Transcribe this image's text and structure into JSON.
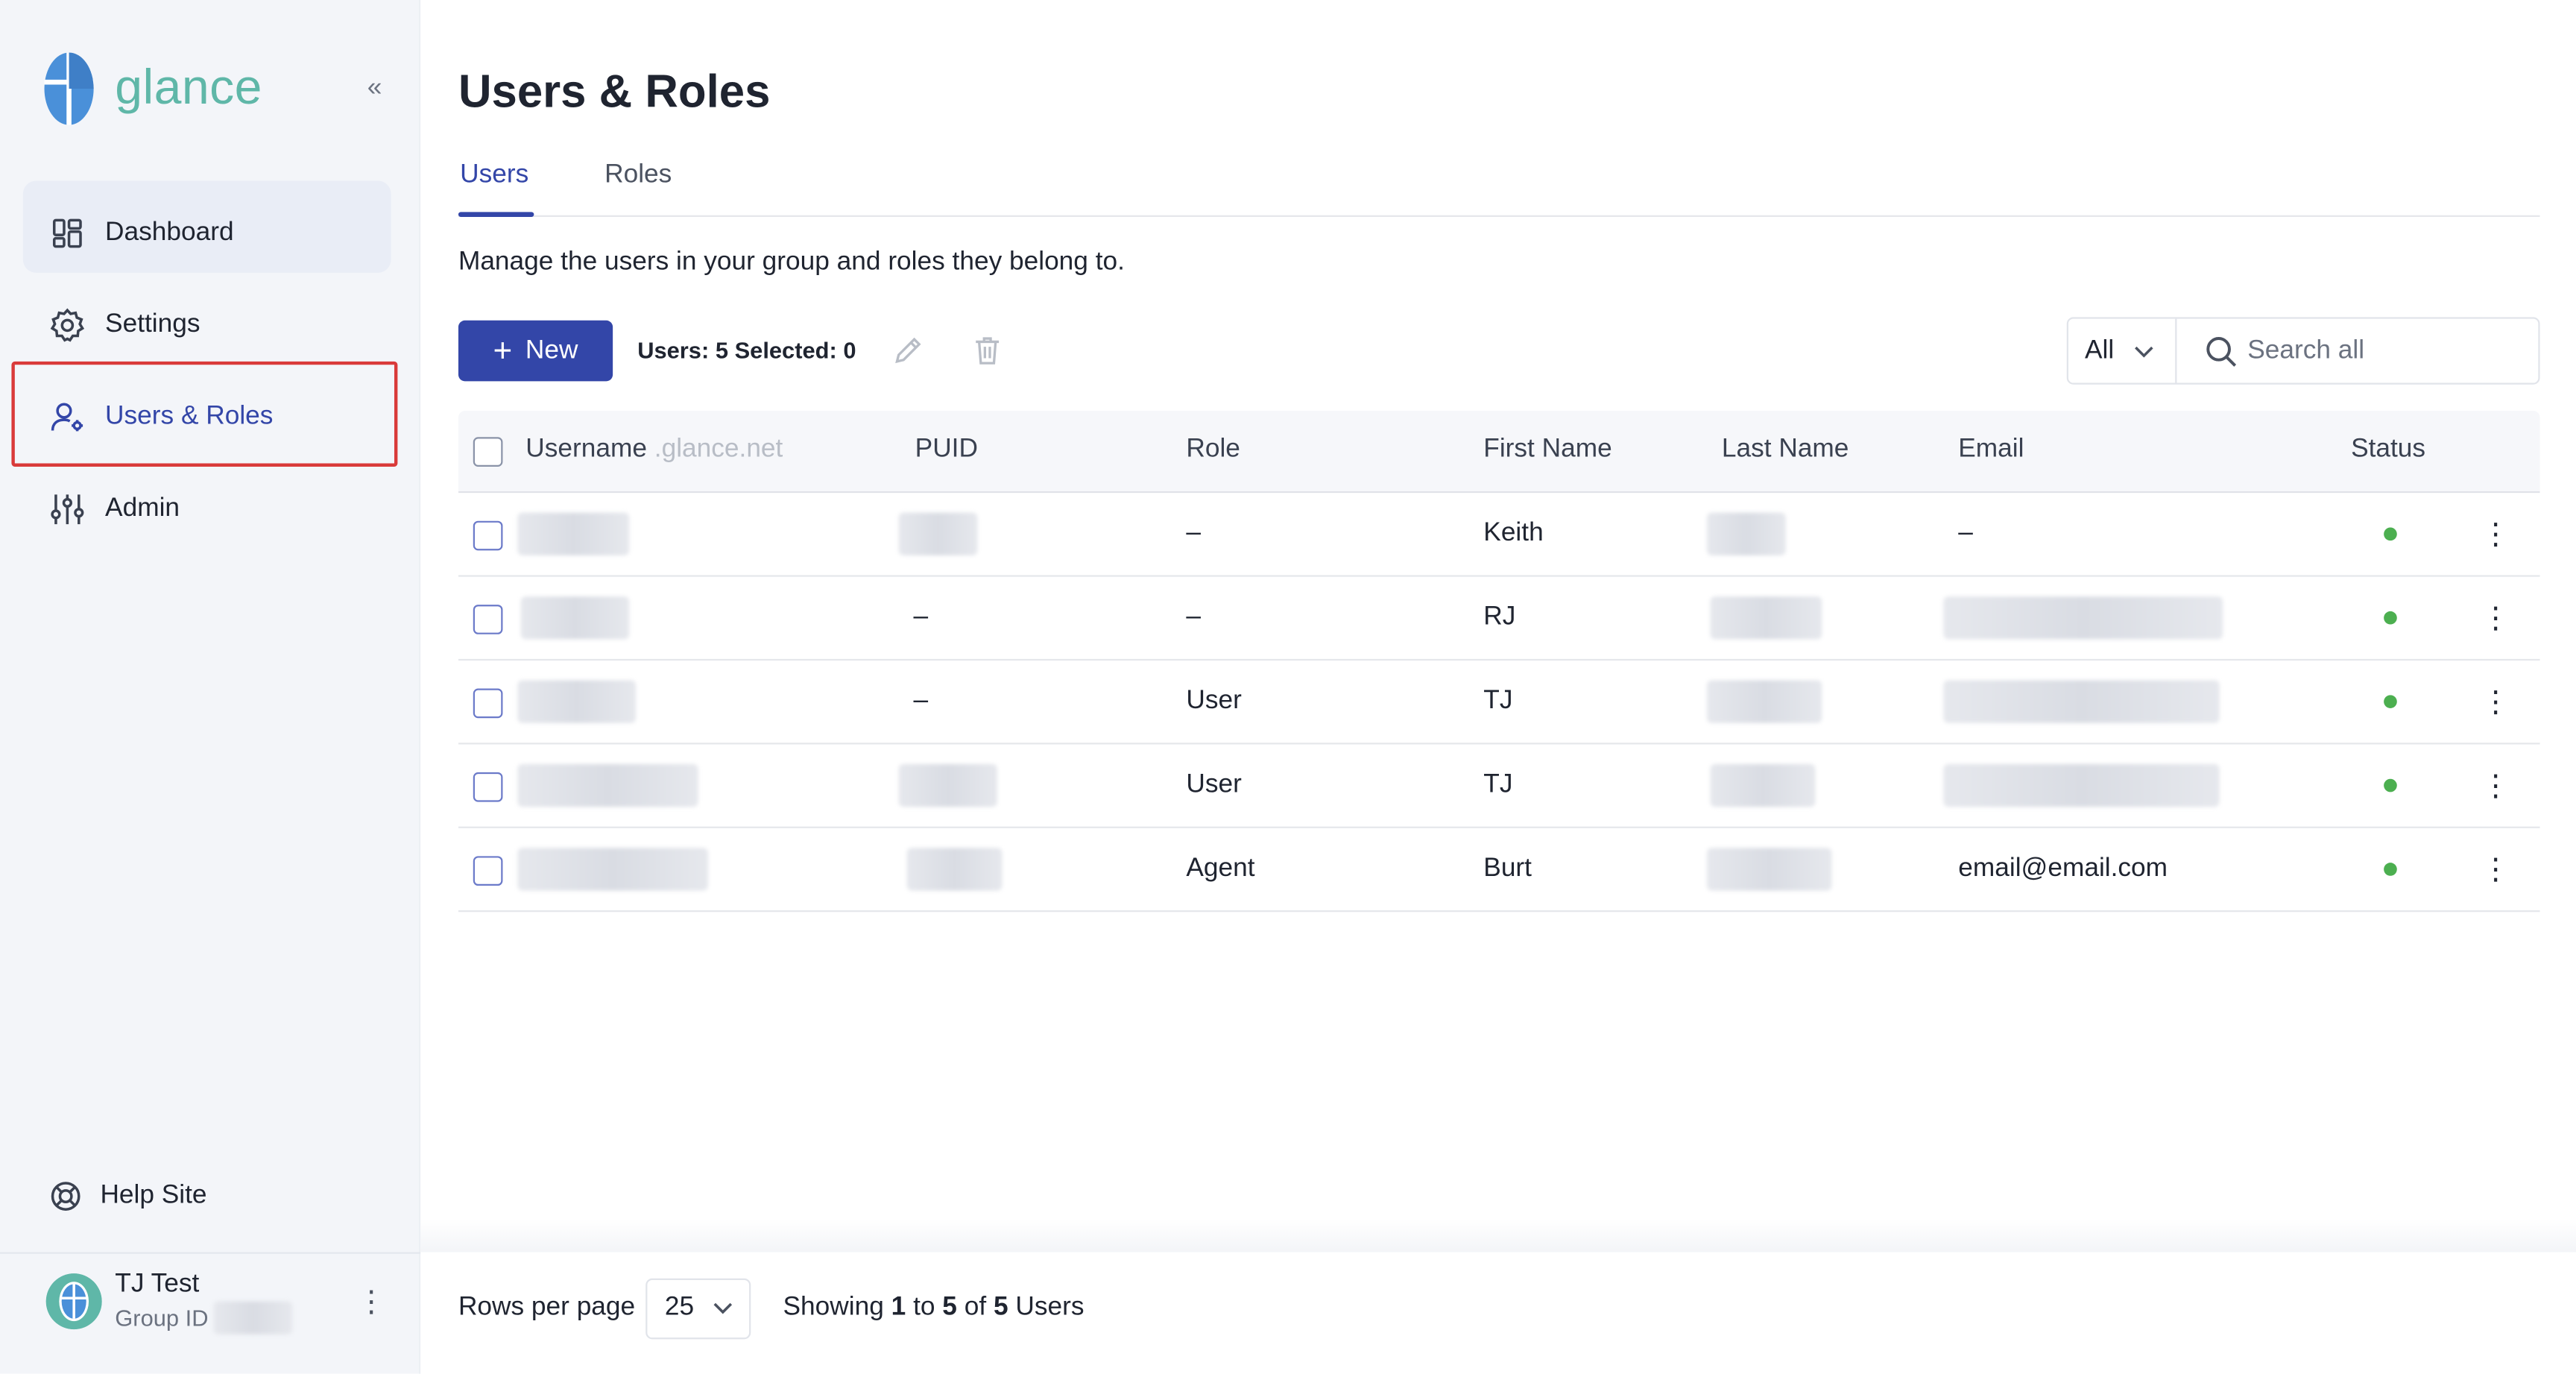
{
  "app": {
    "logo_text": "glance",
    "brand_color": "#5fb7a8",
    "accent_color": "#3346a8",
    "collapse_icon": "double-chevron-left-icon"
  },
  "sidebar": {
    "items": [
      {
        "label": "Dashboard",
        "icon": "dashboard-icon"
      },
      {
        "label": "Settings",
        "icon": "gear-icon"
      },
      {
        "label": "Users & Roles",
        "icon": "users-gear-icon",
        "active": true
      },
      {
        "label": "Admin",
        "icon": "sliders-icon"
      }
    ],
    "help": {
      "label": "Help Site",
      "icon": "lifebuoy-icon"
    },
    "user": {
      "name": "TJ Test",
      "group_label": "Group ID"
    }
  },
  "page": {
    "title": "Users & Roles",
    "tabs": [
      "Users",
      "Roles"
    ],
    "active_tab": "Users",
    "description": "Manage the users in your group and roles they belong to."
  },
  "toolbar": {
    "new_label": "New",
    "users_prefix": "Users: ",
    "users_count": "5",
    "selected_prefix": " Selected: ",
    "selected_count": "0",
    "filter_value": "All",
    "search_placeholder": "Search all"
  },
  "table": {
    "columns": {
      "username": "Username",
      "username_suffix": " .glance.net",
      "puid": "PUID",
      "role": "Role",
      "first_name": "First Name",
      "last_name": "Last Name",
      "email": "Email",
      "status": "Status"
    },
    "rows": [
      {
        "puid": "",
        "role": "–",
        "first_name": "Keith",
        "email": "–",
        "status": "active"
      },
      {
        "puid": "–",
        "role": "–",
        "first_name": "RJ",
        "email": "",
        "status": "active"
      },
      {
        "puid": "–",
        "role": "User",
        "first_name": "TJ",
        "email": "",
        "status": "active"
      },
      {
        "puid": "",
        "role": "User",
        "first_name": "TJ",
        "email": "",
        "status": "active"
      },
      {
        "puid": "",
        "role": "Agent",
        "first_name": "Burt",
        "email": "email@email.com",
        "status": "active"
      }
    ]
  },
  "footer": {
    "rows_per_page_label": "Rows per page",
    "rows_per_page_value": "25",
    "showing_word": "Showing",
    "from": "1",
    "to_word": "to",
    "to": "5",
    "of_word": "of",
    "total": "5",
    "unit": "Users"
  }
}
